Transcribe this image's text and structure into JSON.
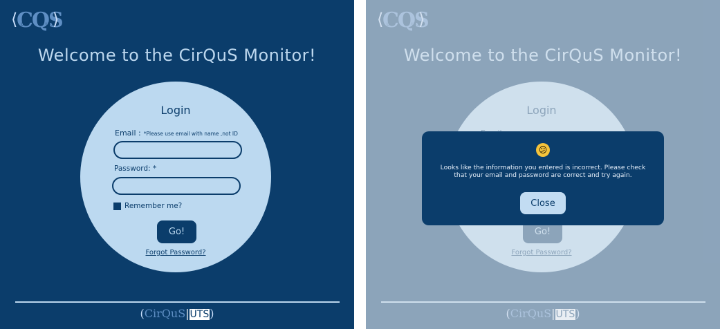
{
  "brand": {
    "logo_text": "CQS",
    "logo_small_left": "UTS",
    "logo_small_right": "UTS"
  },
  "welcome_title": "Welcome to the CirQuS Monitor!",
  "login": {
    "title": "Login",
    "email_label": "Email :",
    "email_hint": "*Please use email with name ,not ID",
    "email_value": "",
    "password_label": "Password: *",
    "password_value": "",
    "remember_label": "Remember me?",
    "go_label": "Go!",
    "forgot_label": "Forgot Password?"
  },
  "footer": {
    "left_bracket": "(",
    "cirqus": "CirQuS",
    "bar": "|",
    "uts": "UTS",
    "right_bracket": ")"
  },
  "modal": {
    "emoji": "😕",
    "message": "Looks like the information you entered is incorrect. Please check that your email and password are correct and try again.",
    "close_label": "Close"
  },
  "colors": {
    "primary": "#0b3d6b",
    "light": "#bcd9f0",
    "overlay": "#dce4ec",
    "emoji": "#f5c33b"
  }
}
